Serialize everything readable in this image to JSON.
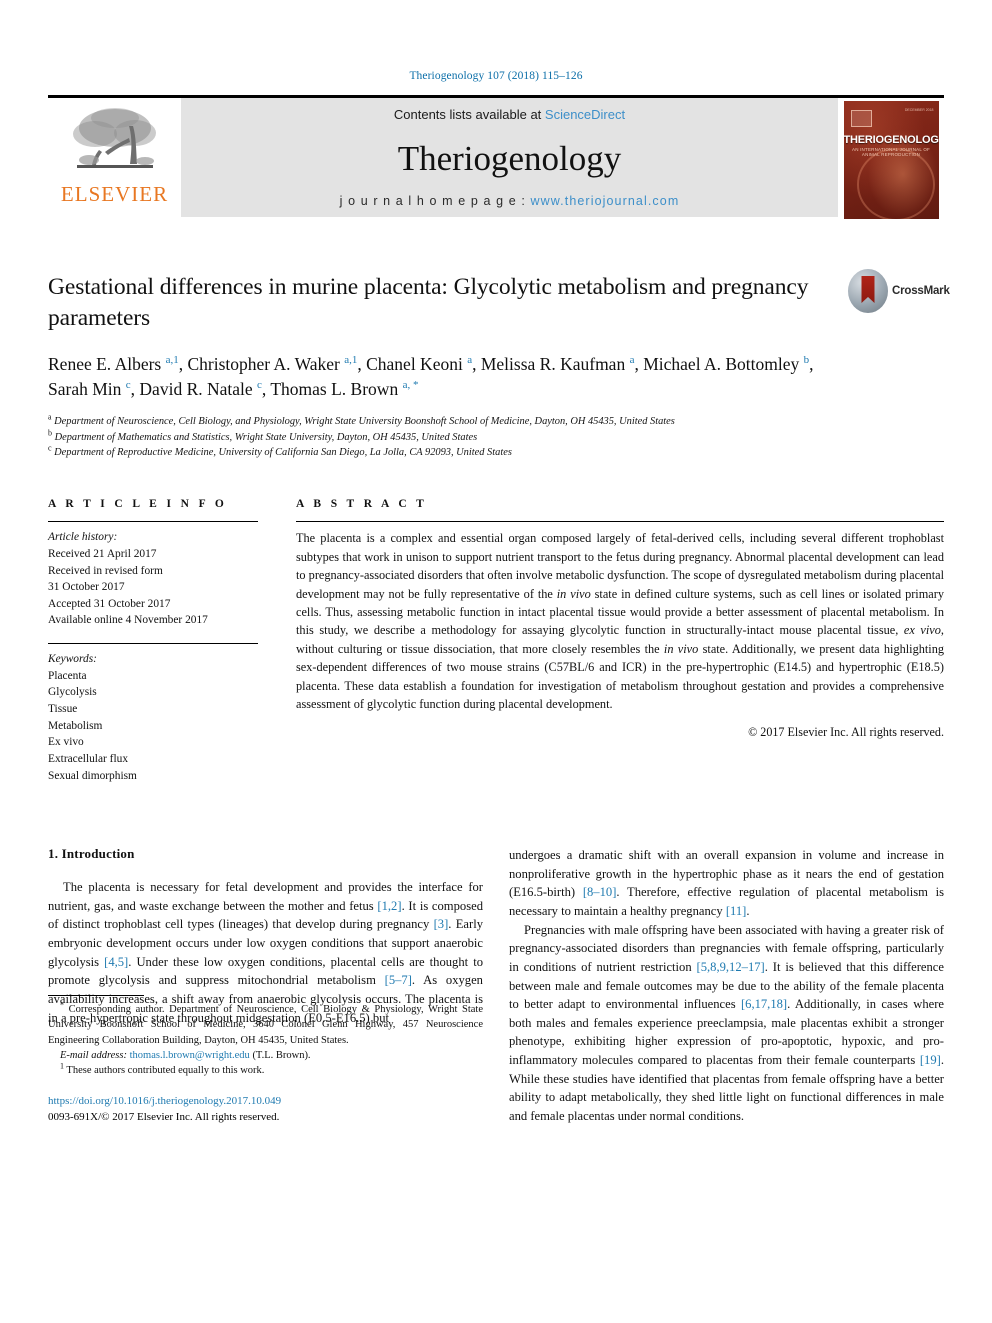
{
  "running_head": "Theriogenology 107 (2018) 115–126",
  "masthead": {
    "publisher_name": "ELSEVIER",
    "publisher_logo": "elsevier-tree-logo",
    "contents_prefix": "Contents lists available at ",
    "contents_link": "ScienceDirect",
    "journal_name": "Theriogenology",
    "homepage_prefix": "j o u r n a l   h o m e p a g e :  ",
    "homepage_url": "www.theriojournal.com",
    "cover": {
      "title": "THERIOGENOLOGY",
      "subtitle": "AN INTERNATIONAL JOURNAL OF ANIMAL REPRODUCTION",
      "corner_note": "DECEMBER 2018"
    }
  },
  "article": {
    "title": "Gestational differences in murine placenta: Glycolytic metabolism and pregnancy parameters",
    "crossmark_label": "CrossMark",
    "authors_html": "Renee E. Albers <sup class=\"affil-marker\">a,1</sup>, Christopher A. Waker <sup class=\"affil-marker\">a,1</sup>, Chanel Keoni <sup class=\"affil-marker\">a</sup>, Melissa R. Kaufman <sup class=\"affil-marker\">a</sup>, Michael A. Bottomley <sup class=\"affil-marker\">b</sup>, Sarah Min <sup class=\"affil-marker\">c</sup>, David R. Natale <sup class=\"affil-marker\">c</sup>, Thomas L. Brown <sup class=\"affil-marker\">a, *</sup>",
    "authors_plain": "Renee E. Albers a,1, Christopher A. Waker a,1, Chanel Keoni a, Melissa R. Kaufman a, Michael A. Bottomley b, Sarah Min c, David R. Natale c, Thomas L. Brown a,*",
    "affiliations": [
      {
        "label": "a",
        "text": "Department of Neuroscience, Cell Biology, and Physiology, Wright State University Boonshoft School of Medicine, Dayton, OH 45435, United States"
      },
      {
        "label": "b",
        "text": "Department of Mathematics and Statistics, Wright State University, Dayton, OH 45435, United States"
      },
      {
        "label": "c",
        "text": "Department of Reproductive Medicine, University of California San Diego, La Jolla, CA 92093, United States"
      }
    ]
  },
  "article_info": {
    "heading": "A R T I C L E   I N F O",
    "history_label": "Article history:",
    "history": [
      "Received 21 April 2017",
      "Received in revised form",
      "31 October 2017",
      "Accepted 31 October 2017",
      "Available online 4 November 2017"
    ],
    "keywords_label": "Keywords:",
    "keywords": [
      "Placenta",
      "Glycolysis",
      "Tissue",
      "Metabolism",
      "Ex vivo",
      "Extracellular flux",
      "Sexual dimorphism"
    ]
  },
  "abstract": {
    "heading": "A B S T R A C T",
    "body_html": "The placenta is a complex and essential organ composed largely of fetal-derived cells, including several different trophoblast subtypes that work in unison to support nutrient transport to the fetus during pregnancy. Abnormal placental development can lead to pregnancy-associated disorders that often involve metabolic dysfunction. The scope of dysregulated metabolism during placental development may not be fully representative of the <i>in vivo</i> state in defined culture systems, such as cell lines or isolated primary cells. Thus, assessing metabolic function in intact placental tissue would provide a better assessment of placental metabolism. In this study, we describe a methodology for assaying glycolytic function in structurally-intact mouse placental tissue, <i>ex vivo</i>, without culturing or tissue dissociation, that more closely resembles the <i>in vivo</i> state. Additionally, we present data highlighting sex-dependent differences of two mouse strains (C57BL/6 and ICR) in the pre-hypertrophic (E14.5) and hypertrophic (E18.5) placenta. These data establish a foundation for investigation of metabolism throughout gestation and provides a comprehensive assessment of glycolytic function during placental development.",
    "copyright": "© 2017 Elsevier Inc. All rights reserved."
  },
  "introduction": {
    "heading": "1. Introduction",
    "left_paragraph_html": "The placenta is necessary for fetal development and provides the interface for nutrient, gas, and waste exchange between the mother and fetus <span class=\"ref\">[1,2]</span>. It is composed of distinct trophoblast cell types (lineages) that develop during pregnancy <span class=\"ref\">[3]</span>. Early embryonic development occurs under low oxygen conditions that support anaerobic glycolysis <span class=\"ref\">[4,5]</span>. Under these low oxygen conditions, placental cells are thought to promote glycolysis and suppress mitochondrial metabolism <span class=\"ref\">[5&#8211;7]</span>. As oxygen availability increases, a shift away from anaerobic glycolysis occurs. The placenta is in a pre-hypertropic state throughout midgestation (E0.5-E16.5) but",
    "right_paragraph_1_html": "undergoes a dramatic shift with an overall expansion in volume and increase in nonproliferative growth in the hypertrophic phase as it nears the end of gestation (E16.5-birth) <span class=\"ref\">[8&#8211;10]</span>. Therefore, effective regulation of placental metabolism is necessary to maintain a healthy pregnancy <span class=\"ref\">[11]</span>.",
    "right_paragraph_2_html": "Pregnancies with male offspring have been associated with having a greater risk of pregnancy-associated disorders than pregnancies with female offspring, particularly in conditions of nutrient restriction <span class=\"ref\">[5,8,9,12&#8211;17]</span>. It is believed that this difference between male and female outcomes may be due to the ability of the female placenta to better adapt to environmental influences <span class=\"ref\">[6,17,18]</span>. Additionally, in cases where both males and females experience preeclampsia, male placentas exhibit a stronger phenotype, exhibiting higher expression of pro-apoptotic, hypoxic, and pro-inflammatory molecules compared to placentas from their female counterparts <span class=\"ref\">[19]</span>. While these studies have identified that placentas from female offspring have a better ability to adapt metabolically, they shed little light on functional differences in male and female placentas under normal conditions."
  },
  "footnotes": {
    "corresponding_html": "<span class=\"marker\">*</span> Corresponding author. Department of Neuroscience, Cell Biology &amp; Physiology, Wright State University Boonshoft School of Medicine, 3640 Colonel Glenn Highway, 457 Neuroscience Engineering Collaboration Building, Dayton, OH 45435, United States.",
    "email_html": "<i>E-mail address:</i> <span class=\"link\">thomas.l.brown@wright.edu</span> (T.L. Brown).",
    "equal_contrib_html": "<span class=\"marker\">1</span> These authors contributed equally to this work.",
    "doi": "https://doi.org/10.1016/j.theriogenology.2017.10.049",
    "issn_line": "0093-691X/© 2017 Elsevier Inc. All rights reserved."
  },
  "colors": {
    "link_blue": "#1f7ab0",
    "masthead_blue": "#3d8fc9",
    "elsevier_orange": "#e87722",
    "masthead_gray": "#e3e3e3",
    "cover_red": "#7a2316"
  }
}
